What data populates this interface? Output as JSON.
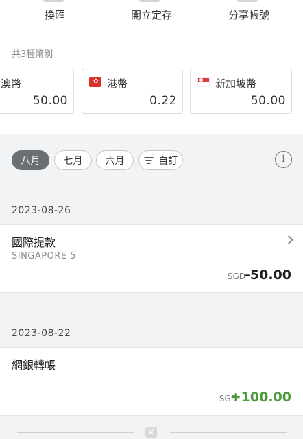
{
  "top_actions": [
    {
      "label": "換匯"
    },
    {
      "label": "開立定存"
    },
    {
      "label": "分享帳號"
    }
  ],
  "currencies": {
    "count_label": "共3種幣別",
    "items": [
      {
        "name": "澳幣",
        "amount": "50.00",
        "flag": "none"
      },
      {
        "name": "港幣",
        "amount": "0.22",
        "flag": "hk-flag"
      },
      {
        "name": "新加坡幣",
        "amount": "50.00",
        "flag": "sg-flag"
      }
    ]
  },
  "filters": {
    "tabs": [
      {
        "label": "八月",
        "active": true
      },
      {
        "label": "七月",
        "active": false
      },
      {
        "label": "六月",
        "active": false
      }
    ],
    "custom_label": "自訂",
    "info_symbol": "i"
  },
  "transactions": [
    {
      "date": "2023-08-26",
      "title": "國際提款",
      "description": "SINGAPORE 5",
      "currency": "SGD",
      "amount": "-50.00",
      "has_detail": true
    },
    {
      "date": "2023-08-22",
      "title": "網銀轉帳",
      "description": "",
      "currency": "SGD",
      "amount": "+100.00",
      "has_detail": false
    }
  ],
  "colors": {
    "positive": "#4a9a3a",
    "negative": "#1f1f1f",
    "active_tab": "#6b6f73"
  }
}
